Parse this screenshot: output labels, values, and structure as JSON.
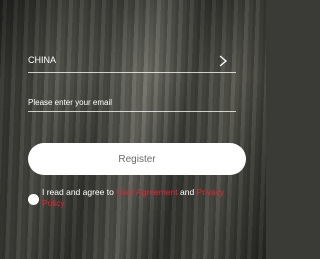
{
  "country": {
    "label": "CHINA",
    "chevron_icon": "chevron-right-icon"
  },
  "email": {
    "placeholder": "Please enter your email",
    "value": ""
  },
  "register": {
    "label": "Register"
  },
  "agreement": {
    "prefix": "I read and agree to ",
    "user_agreement": "User Agreement",
    "middle": " and ",
    "privacy_policy": "Privacy Policy"
  },
  "colors": {
    "link": "#e8232f",
    "button_bg": "#ffffff",
    "button_text": "#6b6b6b"
  }
}
